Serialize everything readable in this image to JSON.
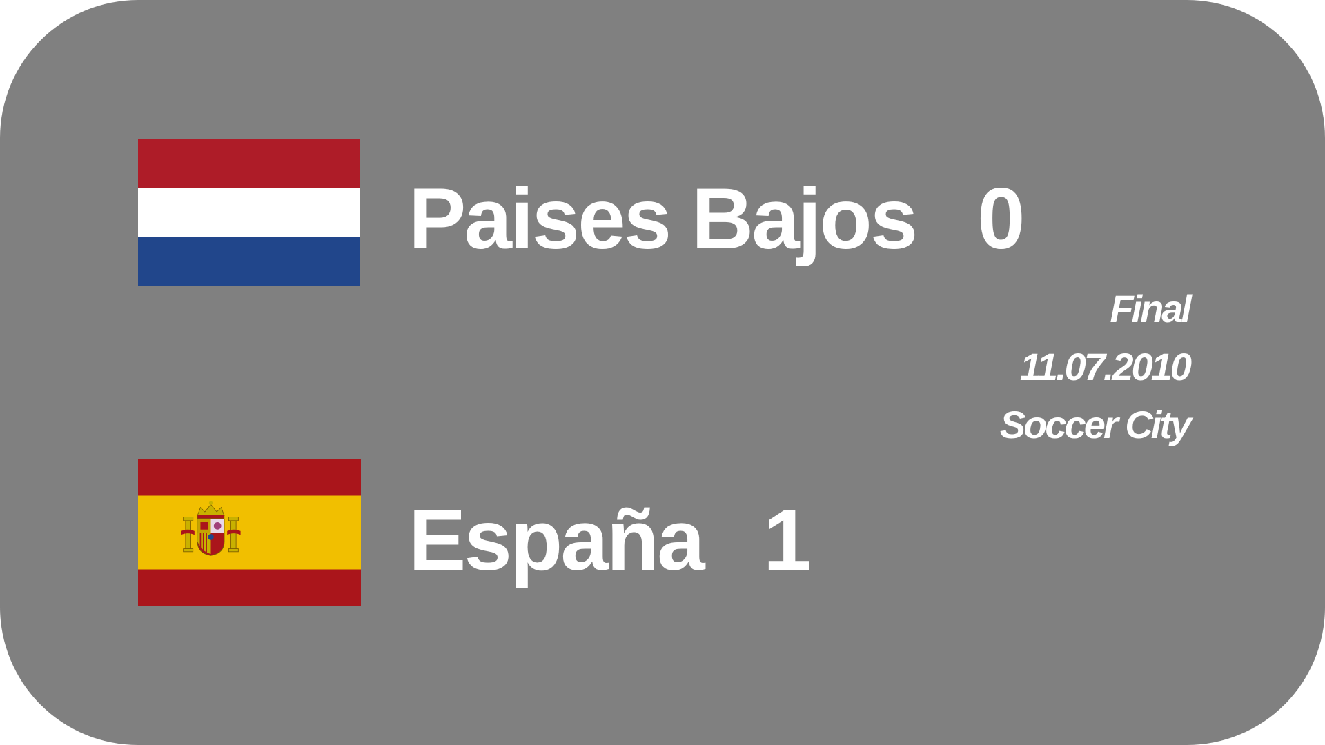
{
  "match": {
    "home": {
      "name": "Paises Bajos",
      "score": "0",
      "flag": "netherlands-flag",
      "colors": [
        "#AE1C28",
        "#FFFFFF",
        "#21468B"
      ]
    },
    "away": {
      "name": "España",
      "score": "1",
      "flag": "spain-flag",
      "colors": [
        "#AA151B",
        "#F1BF00",
        "#AA151B"
      ]
    },
    "stage": "Final",
    "date": "11.07.2010",
    "venue": "Soccer City"
  },
  "style": {
    "card_background": "#808080",
    "text_color": "#FFFFFF"
  }
}
